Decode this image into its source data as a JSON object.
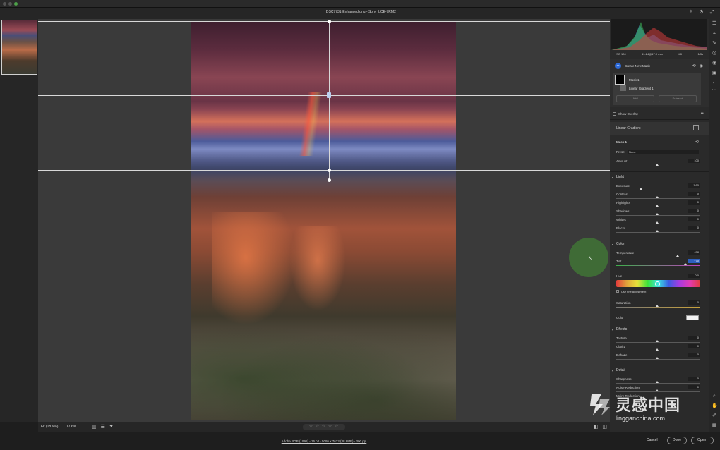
{
  "window": {
    "title": "_DSC7731-Enhanced.dng  -  Sony ILCE-7RM2"
  },
  "histogram": {
    "iso": "ISO 100",
    "lens": "11-24@17.0 mm",
    "aperture": "f/8",
    "shutter": "1/3s"
  },
  "masks": {
    "create_label": "Create New Mask",
    "mask1_label": "Mask 1",
    "gradient_label": "Linear Gradient 1",
    "add_label": "Add",
    "subtract_label": "Subtract",
    "show_overlay_label": "Show Overlay"
  },
  "panel": {
    "tool_title": "Linear Gradient",
    "mask_name": "Mask 1",
    "preset_label": "Preset",
    "preset_value": "None",
    "amount_label": "Amount",
    "amount_value": "100",
    "light": {
      "title": "Light",
      "exposure_label": "Exposure",
      "exposure_value": "-1.60",
      "contrast_label": "Contrast",
      "contrast_value": "0",
      "highlights_label": "Highlights",
      "highlights_value": "0",
      "shadows_label": "Shadows",
      "shadows_value": "0",
      "whites_label": "Whites",
      "whites_value": "0",
      "blacks_label": "Blacks",
      "blacks_value": "0"
    },
    "color": {
      "title": "Color",
      "temperature_label": "Temperature",
      "temperature_value": "+58",
      "tint_label": "Tint",
      "tint_value": "+70",
      "hue_label": "Hue",
      "hue_value": "0.0",
      "fine_adjust_label": "Use fine adjustment",
      "saturation_label": "Saturation",
      "saturation_value": "0",
      "color_label": "Color"
    },
    "effects": {
      "title": "Effects",
      "texture_label": "Texture",
      "texture_value": "0",
      "clarity_label": "Clarity",
      "clarity_value": "0",
      "dehaze_label": "Dehaze",
      "dehaze_value": "0"
    },
    "detail": {
      "title": "Detail",
      "sharpness_label": "Sharpness",
      "sharpness_value": "0",
      "noise_label": "Noise Reduction",
      "noise_value": "0",
      "moire_label": "Moire Reduction"
    }
  },
  "bottombar": {
    "fit_label": "Fit (18.6%)",
    "zoom_label": "17.6%",
    "rating": "☆ ☆ ☆ ☆ ☆"
  },
  "footer": {
    "info": "Adobe RGB (1998) - 16 bit - 5095 x 7623 (38.8MP) - 300 ppi",
    "cancel_label": "Cancel",
    "done_label": "Done",
    "open_label": "Open"
  },
  "watermark": {
    "cn": "灵感中国",
    "en": "lingganchina.com"
  },
  "colors": {
    "accent": "#2d6ad8",
    "panel_bg": "#2a2a2a",
    "canvas_bg": "#3a3a3a",
    "cursor_circle": "#3f6b36"
  }
}
